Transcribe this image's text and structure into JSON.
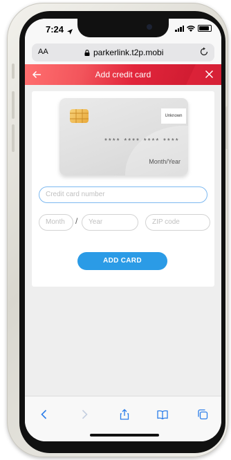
{
  "status": {
    "time": "7:24"
  },
  "browser": {
    "text_size_label": "AA",
    "url": "parkerlink.t2p.mobi"
  },
  "header": {
    "title": "Add credit card"
  },
  "card_preview": {
    "brand": "Unknown",
    "number_mask": "**** **** **** ****",
    "expiry_placeholder": "Month/Year"
  },
  "form": {
    "card_number_placeholder": "Credit card number",
    "month_placeholder": "Month",
    "separator": "/",
    "year_placeholder": "Year",
    "zip_placeholder": "ZIP code",
    "submit_label": "ADD CARD"
  },
  "colors": {
    "header_red": "#e8293f",
    "button_blue": "#2b9be6",
    "field_focus": "#7cb8f0"
  }
}
